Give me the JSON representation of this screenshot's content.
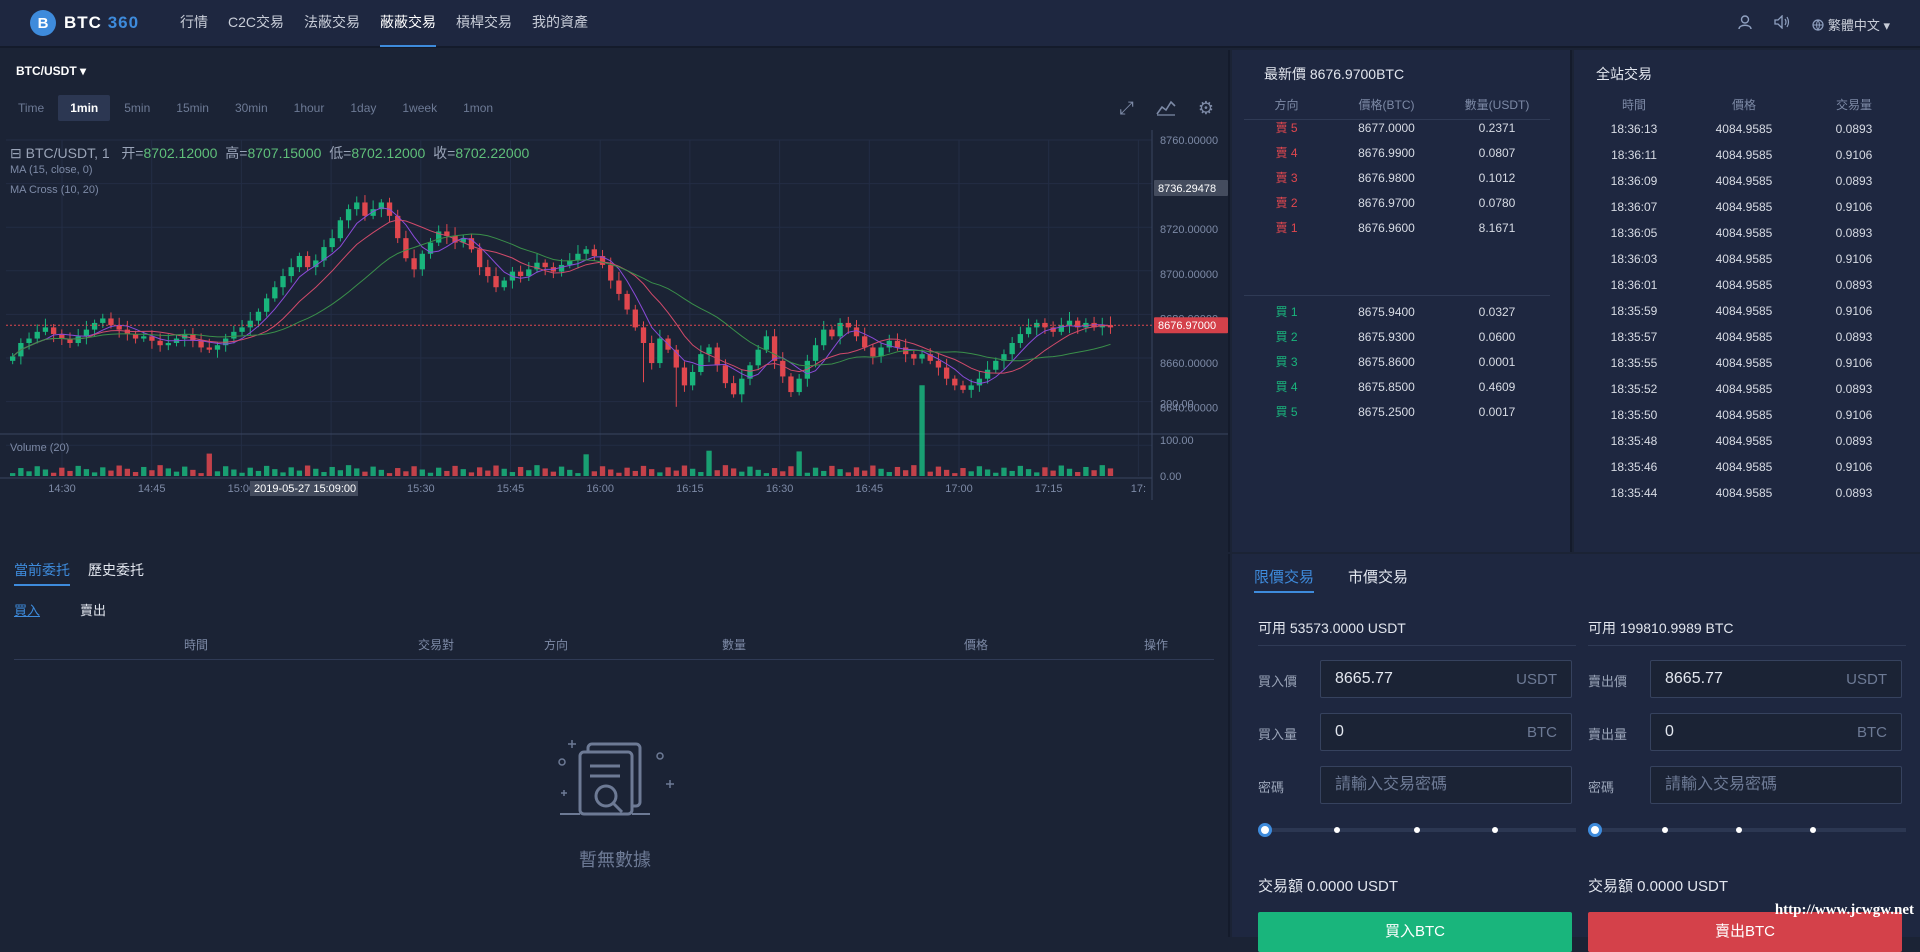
{
  "app": {
    "logo_glyph": "B",
    "logo_name": "BTC",
    "logo_num": "360",
    "nav": [
      "行情",
      "C2C交易",
      "法蔽交易",
      "蔽蔽交易",
      "槓桿交易",
      "我的資產"
    ],
    "language": "繁體中文",
    "icons": [
      "user-icon",
      "speaker-icon",
      "globe-icon"
    ]
  },
  "chart": {
    "pair": "BTC/USDT",
    "intervals": [
      "Time",
      "1min",
      "5min",
      "15min",
      "30min",
      "1hour",
      "1day",
      "1week",
      "1mon"
    ],
    "active_interval": "1min",
    "legend_prefix": "BTC/USDT, 1",
    "open_label": "开=",
    "open": "8702.12000",
    "high_label": "高=",
    "high": "8707.15000",
    "low_label": "低=",
    "low": "8702.12000",
    "close_label": "收=",
    "close": "8702.22000",
    "ma_label": "MA (15, close, 0)",
    "macross_label": "MA Cross (10, 20)",
    "volume_label": "Volume (20)",
    "current_price_tag": "8676.97000",
    "crosshair_price_tag": "8736.29478",
    "crosshair_time": "2019-05-27 15:09:00",
    "colors": {
      "up": "#19b57c",
      "down": "#e0474e",
      "ma1": "#8a4bd8",
      "ma2": "#d04a6a",
      "ma3": "#3a8f4a"
    }
  },
  "chart_data": {
    "type": "candlestick",
    "y_ticks": [
      "8760.00000",
      "8740.00000",
      "8720.00000",
      "8700.00000",
      "8680.00000",
      "8660.00000",
      "8640.00000"
    ],
    "ylim": [
      8630,
      8760
    ],
    "vol_ticks": [
      "200.00",
      "100.00",
      "0.00"
    ],
    "vol_lim": [
      0,
      260
    ],
    "x_ticks": [
      "14:30",
      "14:45",
      "15:00",
      "15:15",
      "15:30",
      "15:45",
      "16:00",
      "16:15",
      "16:30",
      "16:45",
      "17:00",
      "17:15",
      "17:"
    ],
    "closes": [
      8663,
      8669,
      8671,
      8674,
      8676,
      8673,
      8671,
      8669,
      8672,
      8675,
      8678,
      8680,
      8677,
      8675,
      8673,
      8671,
      8672,
      8670,
      8668,
      8669,
      8671,
      8673,
      8670,
      8667,
      8666,
      8668,
      8671,
      8674,
      8676,
      8679,
      8683,
      8689,
      8694,
      8699,
      8703,
      8708,
      8703,
      8706,
      8712,
      8716,
      8724,
      8729,
      8732,
      8726,
      8729,
      8732,
      8726,
      8716,
      8707,
      8702,
      8709,
      8714,
      8719,
      8717,
      8714,
      8716,
      8711,
      8703,
      8699,
      8694,
      8697,
      8701,
      8699,
      8702,
      8705,
      8703,
      8701,
      8704,
      8706,
      8709,
      8711,
      8708,
      8704,
      8697,
      8691,
      8684,
      8676,
      8669,
      8660,
      8671,
      8666,
      8658,
      8650,
      8656,
      8664,
      8667,
      8659,
      8651,
      8646,
      8653,
      8659,
      8666,
      8672,
      8661,
      8654,
      8647,
      8653,
      8661,
      8668,
      8675,
      8672,
      8678,
      8676,
      8672,
      8667,
      8663,
      8667,
      8670,
      8667,
      8664,
      8662,
      8664,
      8661,
      8658,
      8653,
      8650,
      8648,
      8650,
      8653,
      8657,
      8661,
      8664,
      8669,
      8673,
      8676,
      8678,
      8676,
      8674,
      8677,
      8679,
      8676,
      8678,
      8676,
      8677,
      8676
    ]
  },
  "orderbook": {
    "title": "最新價 8676.9700BTC",
    "headers": [
      "方向",
      "價格(BTC)",
      "數量(USDT)"
    ],
    "asks": [
      {
        "side": "賣 5",
        "price": "8677.0000",
        "qty": "0.2371"
      },
      {
        "side": "賣 4",
        "price": "8676.9900",
        "qty": "0.0807"
      },
      {
        "side": "賣 3",
        "price": "8676.9800",
        "qty": "0.1012"
      },
      {
        "side": "賣 2",
        "price": "8676.9700",
        "qty": "0.0780"
      },
      {
        "side": "賣 1",
        "price": "8676.9600",
        "qty": "8.1671"
      }
    ],
    "bids": [
      {
        "side": "買 1",
        "price": "8675.9400",
        "qty": "0.0327"
      },
      {
        "side": "買 2",
        "price": "8675.9300",
        "qty": "0.0600"
      },
      {
        "side": "買 3",
        "price": "8675.8600",
        "qty": "0.0001"
      },
      {
        "side": "買 4",
        "price": "8675.8500",
        "qty": "0.4609"
      },
      {
        "side": "買 5",
        "price": "8675.2500",
        "qty": "0.0017"
      }
    ]
  },
  "trades": {
    "title": "全站交易",
    "headers": [
      "時間",
      "價格",
      "交易量"
    ],
    "rows": [
      {
        "time": "18:36:13",
        "price": "4084.9585",
        "vol": "0.0893"
      },
      {
        "time": "18:36:11",
        "price": "4084.9585",
        "vol": "0.9106"
      },
      {
        "time": "18:36:09",
        "price": "4084.9585",
        "vol": "0.0893"
      },
      {
        "time": "18:36:07",
        "price": "4084.9585",
        "vol": "0.9106"
      },
      {
        "time": "18:36:05",
        "price": "4084.9585",
        "vol": "0.0893"
      },
      {
        "time": "18:36:03",
        "price": "4084.9585",
        "vol": "0.9106"
      },
      {
        "time": "18:36:01",
        "price": "4084.9585",
        "vol": "0.0893"
      },
      {
        "time": "18:35:59",
        "price": "4084.9585",
        "vol": "0.9106"
      },
      {
        "time": "18:35:57",
        "price": "4084.9585",
        "vol": "0.0893"
      },
      {
        "time": "18:35:55",
        "price": "4084.9585",
        "vol": "0.9106"
      },
      {
        "time": "18:35:52",
        "price": "4084.9585",
        "vol": "0.0893"
      },
      {
        "time": "18:35:50",
        "price": "4084.9585",
        "vol": "0.9106"
      },
      {
        "time": "18:35:48",
        "price": "4084.9585",
        "vol": "0.0893"
      },
      {
        "time": "18:35:46",
        "price": "4084.9585",
        "vol": "0.9106"
      },
      {
        "time": "18:35:44",
        "price": "4084.9585",
        "vol": "0.0893"
      }
    ]
  },
  "orders": {
    "tabs": [
      "當前委托",
      "歷史委托"
    ],
    "sub_tabs": [
      "買入",
      "賣出"
    ],
    "headers": [
      "時間",
      "交易對",
      "方向",
      "數量",
      "價格",
      "操作"
    ],
    "empty_text": "暫無數據"
  },
  "trade_form": {
    "tabs": [
      "限價交易",
      "市價交易"
    ],
    "buy": {
      "available": "可用 53573.0000 USDT",
      "price_label": "買入價",
      "price_value": "8665.77",
      "price_unit": "USDT",
      "qty_label": "買入量",
      "qty_value": "0",
      "qty_unit": "BTC",
      "pwd_label": "密碼",
      "pwd_placeholder": "請輸入交易密碼",
      "amount": "交易額 0.0000 USDT",
      "button": "買入BTC"
    },
    "sell": {
      "available": "可用 199810.9989 BTC",
      "price_label": "賣出價",
      "price_value": "8665.77",
      "price_unit": "USDT",
      "qty_label": "賣出量",
      "qty_value": "0",
      "qty_unit": "BTC",
      "pwd_label": "密碼",
      "pwd_placeholder": "請輸入交易密碼",
      "amount": "交易額 0.0000 USDT",
      "button": "賣出BTC"
    }
  },
  "watermark": "http://www.jcwgw.net"
}
